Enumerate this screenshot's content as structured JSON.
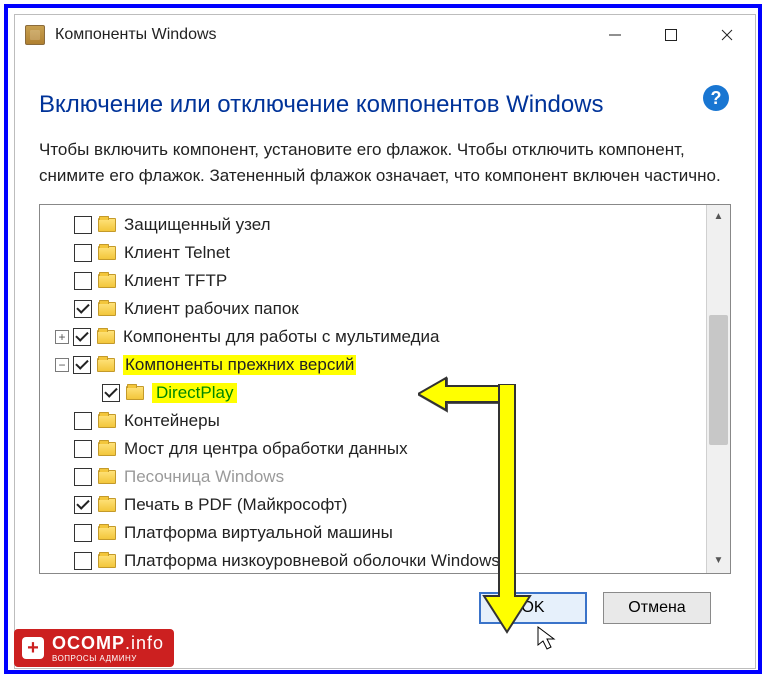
{
  "title": "Компоненты Windows",
  "heading": "Включение или отключение компонентов Windows",
  "description": "Чтобы включить компонент, установите его флажок. Чтобы отключить компонент, снимите его флажок. Затененный флажок означает, что компонент включен частично.",
  "help_symbol": "?",
  "tree": [
    {
      "label": "Защищенный узел",
      "checked": false,
      "indent": 0,
      "exp": null,
      "highlight": false
    },
    {
      "label": "Клиент Telnet",
      "checked": false,
      "indent": 0,
      "exp": null,
      "highlight": false
    },
    {
      "label": "Клиент TFTP",
      "checked": false,
      "indent": 0,
      "exp": null,
      "highlight": false
    },
    {
      "label": "Клиент рабочих папок",
      "checked": true,
      "indent": 0,
      "exp": null,
      "highlight": false
    },
    {
      "label": "Компоненты для работы с мультимедиа",
      "checked": true,
      "indent": 0,
      "exp": "+",
      "highlight": false
    },
    {
      "label": "Компоненты прежних версий",
      "checked": true,
      "indent": 0,
      "exp": "-",
      "highlight": true
    },
    {
      "label": "DirectPlay",
      "checked": true,
      "indent": 1,
      "exp": null,
      "highlight": true,
      "green": true
    },
    {
      "label": "Контейнеры",
      "checked": false,
      "indent": 0,
      "exp": null,
      "highlight": false
    },
    {
      "label": "Мост для центра обработки данных",
      "checked": false,
      "indent": 0,
      "exp": null,
      "highlight": false
    },
    {
      "label": "Песочница Windows",
      "checked": false,
      "indent": 0,
      "exp": null,
      "highlight": false,
      "disabled": true
    },
    {
      "label": "Печать в PDF (Майкрософт)",
      "checked": true,
      "indent": 0,
      "exp": null,
      "highlight": false
    },
    {
      "label": "Платформа виртуальной машины",
      "checked": false,
      "indent": 0,
      "exp": null,
      "highlight": false
    },
    {
      "label": "Платформа низкоуровневой оболочки Windows",
      "checked": false,
      "indent": 0,
      "exp": null,
      "highlight": false
    }
  ],
  "buttons": {
    "ok": "OK",
    "cancel": "Отмена"
  },
  "watermark": {
    "brand": "OCOMP",
    "tld": ".info",
    "sub": "ВОПРОСЫ АДМИНУ"
  },
  "exp_symbols": {
    "plus": "+",
    "minus": "−"
  },
  "scroll_arrows": {
    "up": "▲",
    "down": "▼"
  }
}
